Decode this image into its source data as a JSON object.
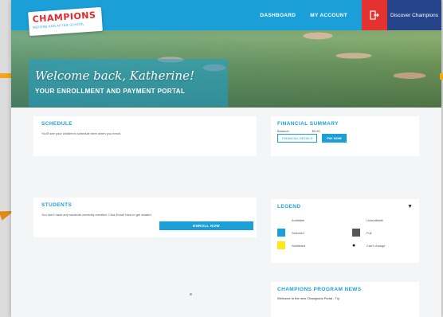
{
  "header": {
    "logo_main": "CHAMPIONS",
    "logo_sub": "BEFORE AND AFTER SCHOOL",
    "nav": [
      "DASHBOARD",
      "MY ACCOUNT"
    ],
    "discover_label": "Discover Champions"
  },
  "hero": {
    "welcome": "Welcome back, Katherine!",
    "subtitle": "YOUR ENROLLMENT AND PAYMENT PORTAL"
  },
  "schedule": {
    "title": "SCHEDULE",
    "text": "You'll see your children's schedule here when you enroll."
  },
  "students": {
    "title": "STUDENTS",
    "text": "You don't have any students currently enrolled. Click Enroll Now to get started.",
    "enroll_label": "ENROLL NOW"
  },
  "financial": {
    "title": "FINANCIAL SUMMARY",
    "balance_label": "Balance:",
    "balance_value": "$0.00",
    "details_label": "FINANCIAL DETAILS",
    "pay_label": "PAY NOW"
  },
  "legend": {
    "title": "LEGEND",
    "items": [
      {
        "label": "Available",
        "color": "#ffffff"
      },
      {
        "label": "Unavailable",
        "color": "#ffffff"
      },
      {
        "label": "Selected",
        "color": "#1b9fd8"
      },
      {
        "label": "Full",
        "color": "#555555"
      },
      {
        "label": "Waitlisted",
        "color": "#ffe81a"
      },
      {
        "label": "Can't change",
        "color": "#ffffff"
      }
    ]
  },
  "news": {
    "title": "CHAMPIONS PROGRAM NEWS",
    "text": "Welcome to the new Champions Portal - Try"
  },
  "colors": {
    "brand_blue": "#1b9fd8",
    "logout_red": "#e3322f",
    "navy": "#26448a",
    "accent_orange": "#f4a51c"
  }
}
